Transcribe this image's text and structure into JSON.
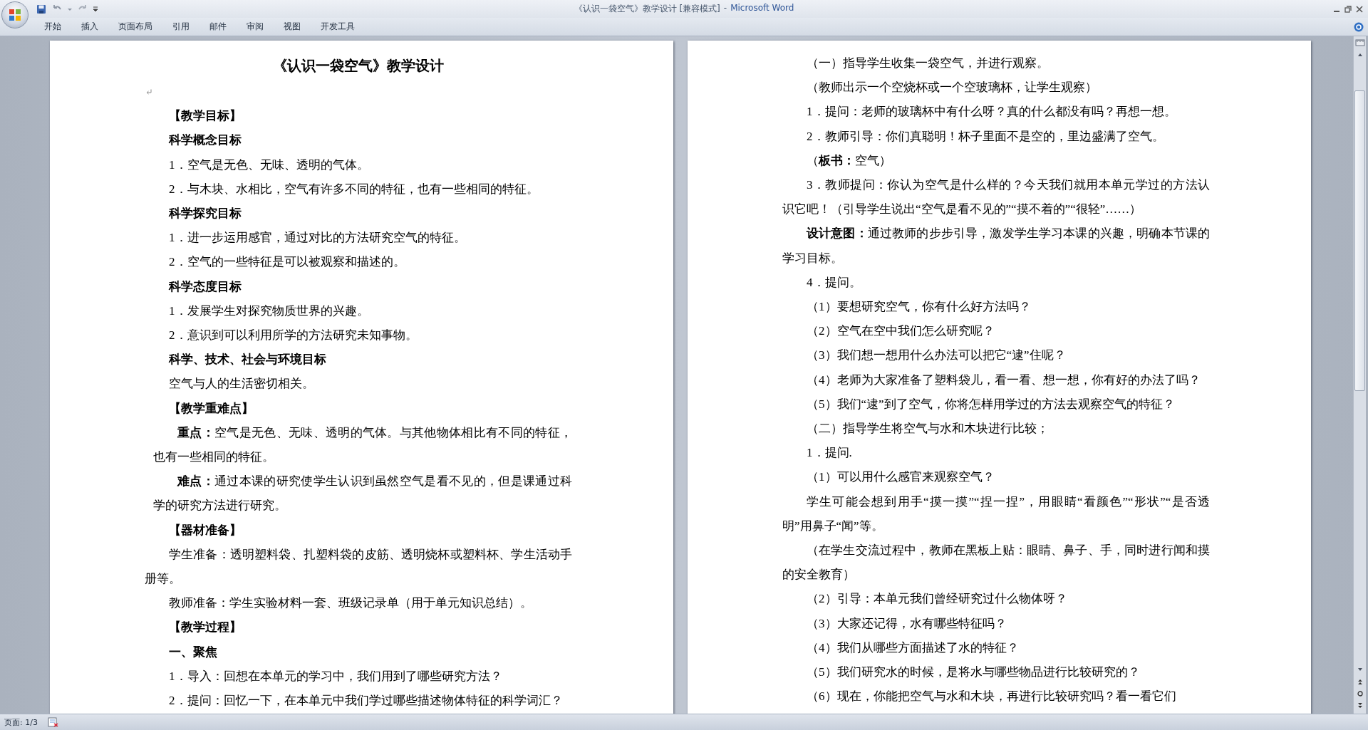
{
  "window": {
    "title": "《认识一袋空气》教学设计 [兼容模式]",
    "separator": "-",
    "app_name": "Microsoft Word"
  },
  "ribbon_tabs": [
    {
      "label": "开始"
    },
    {
      "label": "插入"
    },
    {
      "label": "页面布局"
    },
    {
      "label": "引用"
    },
    {
      "label": "邮件"
    },
    {
      "label": "审阅"
    },
    {
      "label": "视图"
    },
    {
      "label": "开发工具"
    }
  ],
  "document": {
    "pages": [
      {
        "paragraphs": [
          {
            "kind": "title",
            "text": "《认识一袋空气》教学设计"
          },
          {
            "kind": "blank"
          },
          {
            "kind": "heading",
            "text": "【教学目标】"
          },
          {
            "kind": "heading",
            "text": "科学概念目标"
          },
          {
            "kind": "text",
            "text": "1．空气是无色、无味、透明的气体。"
          },
          {
            "kind": "text",
            "text": "2．与木块、水相比，空气有许多不同的特征，也有一些相同的特征。"
          },
          {
            "kind": "heading",
            "text": "科学探究目标"
          },
          {
            "kind": "text",
            "text": "1．进一步运用感官，通过对比的方法研究空气的特征。"
          },
          {
            "kind": "text",
            "text": "2．空气的一些特征是可以被观察和描述的。"
          },
          {
            "kind": "heading",
            "text": "科学态度目标"
          },
          {
            "kind": "text",
            "text": "1．发展学生对探究物质世界的兴趣。"
          },
          {
            "kind": "text",
            "text": "2．意识到可以利用所学的方法研究未知事物。"
          },
          {
            "kind": "heading",
            "text": "科学、技术、社会与环境目标"
          },
          {
            "kind": "text",
            "text": "空气与人的生活密切相关。"
          },
          {
            "kind": "heading",
            "text": "【教学重难点】"
          },
          {
            "kind": "note",
            "text": "**重点：**空气是无色、无味、透明的气体。与其他物体相比有不同的特征，也有一些相同的特征。"
          },
          {
            "kind": "note",
            "text": "**难点：**通过本课的研究使学生认识到虽然空气是看不见的，但是课通过科学的研究方法进行研究。"
          },
          {
            "kind": "heading",
            "text": "【器材准备】"
          },
          {
            "kind": "text",
            "text": "学生准备：透明塑料袋、扎塑料袋的皮筋、透明烧杯或塑料杯、学生活动手册等。"
          },
          {
            "kind": "text",
            "text": "教师准备：学生实验材料一套、班级记录单（用于单元知识总结）。"
          },
          {
            "kind": "heading",
            "text": "【教学过程】"
          },
          {
            "kind": "heading",
            "text": "一、聚焦"
          },
          {
            "kind": "text",
            "text": "1．导入：回想在本单元的学习中，我们用到了哪些研究方法？"
          },
          {
            "kind": "text",
            "text": "2．提问：回忆一下，在本单元中我们学过哪些描述物体特征的科学词汇？"
          }
        ]
      },
      {
        "paragraphs": [
          {
            "kind": "text",
            "text": "（一）指导学生收集一袋空气，并进行观察。"
          },
          {
            "kind": "text",
            "text": "（教师出示一个空烧杯或一个空玻璃杯，让学生观察）"
          },
          {
            "kind": "text",
            "text": "1．提问：老师的玻璃杯中有什么呀？真的什么都没有吗？再想一想。"
          },
          {
            "kind": "text",
            "text": "2．教师引导：你们真聪明！杯子里面不是空的，里边盛满了空气。"
          },
          {
            "kind": "text",
            "text": "（**板书：**空气）"
          },
          {
            "kind": "text",
            "text": "3．教师提问：你认为空气是什么样的？今天我们就用本单元学过的方法认识它吧！（引导学生说出“空气是看不见的”“摸不着的”“很轻”……）"
          },
          {
            "kind": "text",
            "text": "**设计意图：**通过教师的步步引导，激发学生学习本课的兴趣，明确本节课的学习目标。"
          },
          {
            "kind": "text",
            "text": "4．提问。"
          },
          {
            "kind": "text",
            "text": "（1）要想研究空气，你有什么好方法吗？"
          },
          {
            "kind": "text",
            "text": "（2）空气在空中我们怎么研究呢？"
          },
          {
            "kind": "text",
            "text": "（3）我们想一想用什么办法可以把它“逮”住呢？"
          },
          {
            "kind": "text",
            "text": "（4）老师为大家准备了塑料袋儿，看一看、想一想，你有好的办法了吗？"
          },
          {
            "kind": "text",
            "text": "（5）我们“逮”到了空气，你将怎样用学过的方法去观察空气的特征？"
          },
          {
            "kind": "text",
            "text": "（二）指导学生将空气与水和木块进行比较；"
          },
          {
            "kind": "text",
            "text": "1．提问."
          },
          {
            "kind": "text",
            "text": "（1）可以用什么感官来观察空气？"
          },
          {
            "kind": "text",
            "text": "学生可能会想到用手“摸一摸”“捏一捏”，用眼睛“看颜色”“形状”“是否透明”用鼻子“闻”等。"
          },
          {
            "kind": "text",
            "text": "（在学生交流过程中，教师在黑板上贴：眼睛、鼻子、手，同时进行闻和摸的安全教育）"
          },
          {
            "kind": "text",
            "text": "（2）引导：本单元我们曾经研究过什么物体呀？"
          },
          {
            "kind": "text",
            "text": "（3）大家还记得，水有哪些特征吗？"
          },
          {
            "kind": "text",
            "text": "（4）我们从哪些方面描述了水的特征？"
          },
          {
            "kind": "text",
            "text": "（5）我们研究水的时候，是将水与哪些物品进行比较研究的？"
          },
          {
            "kind": "text",
            "text": "（6）现在，你能把空气与水和木块，再进行比较研究吗？看一看它们"
          }
        ]
      }
    ]
  },
  "status_bar": {
    "page_info": "页面: 1/3"
  }
}
